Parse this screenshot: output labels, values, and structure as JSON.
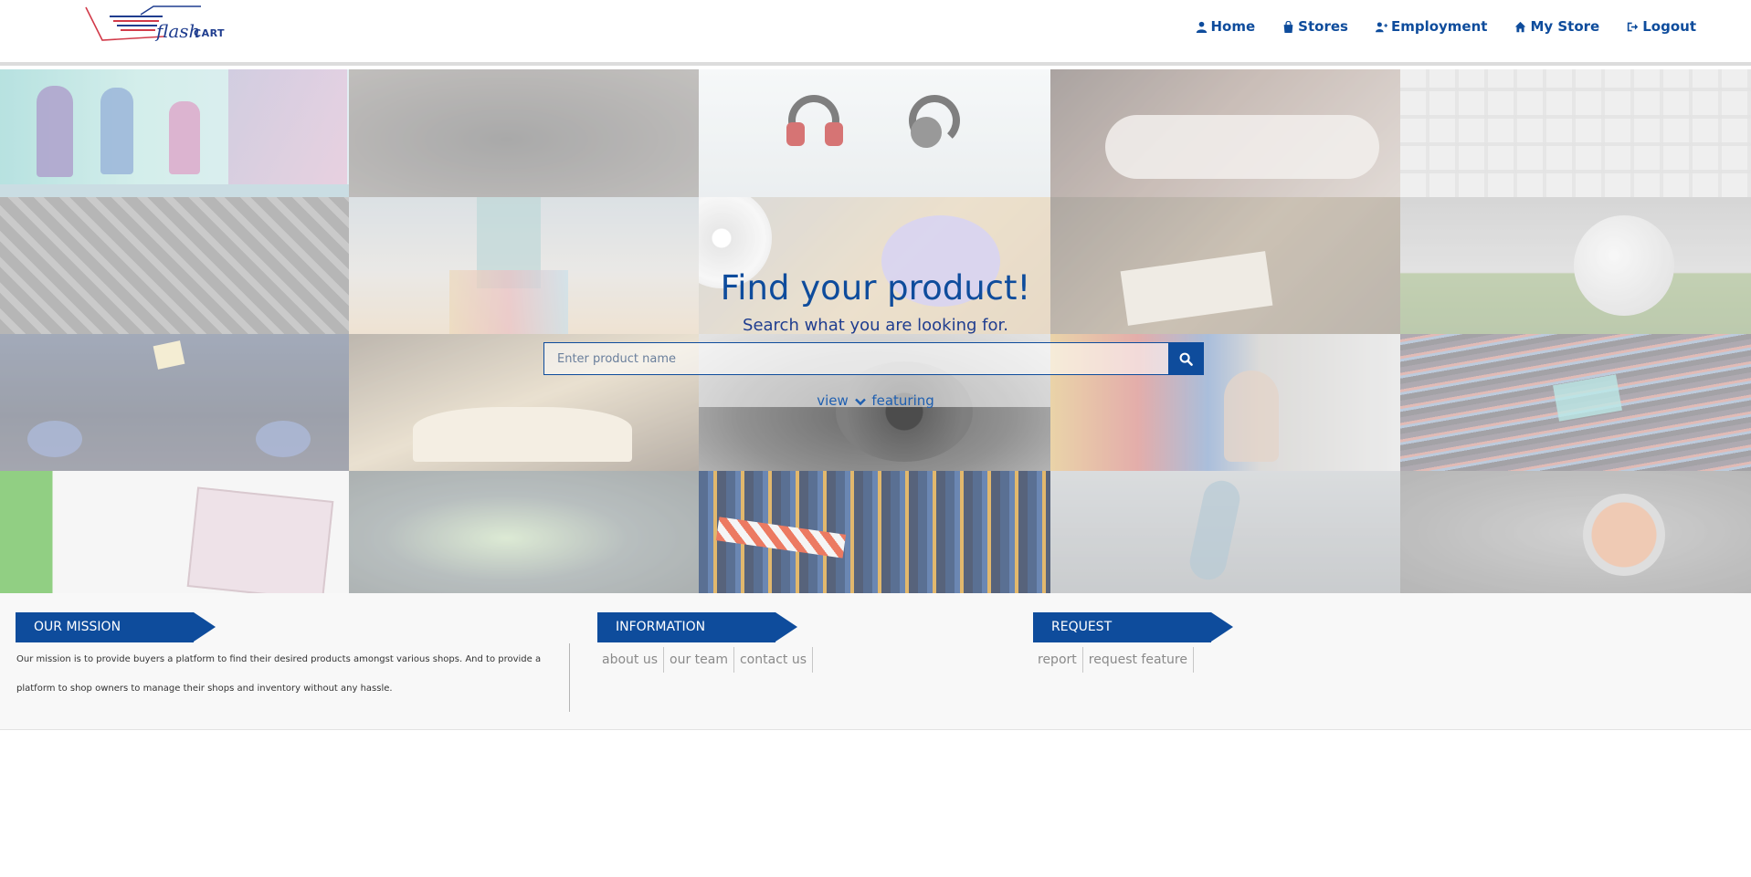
{
  "brand": {
    "name": "flash",
    "suffix": "CART"
  },
  "nav": {
    "items": [
      {
        "label": "Home",
        "icon": "user-icon"
      },
      {
        "label": "Stores",
        "icon": "shopping-bag-icon"
      },
      {
        "label": "Employment",
        "icon": "user-plus-icon"
      },
      {
        "label": "My Store",
        "icon": "home-icon"
      },
      {
        "label": "Logout",
        "icon": "sign-out-icon"
      }
    ]
  },
  "hero": {
    "title": "Find your product!",
    "subtitle": "Search what you are looking for.",
    "search_placeholder": "Enter product name",
    "view_label": "view",
    "featuring_label": "featuring"
  },
  "footer": {
    "mission": {
      "heading": "OUR MISSION",
      "text": "Our mission is to provide buyers a platform to find their desired products amongst various shops. And to provide a platform to shop owners to manage their shops and inventory without any hassle."
    },
    "information": {
      "heading": "INFORMATION",
      "links": [
        "about us",
        "our team",
        "contact us"
      ]
    },
    "request": {
      "heading": "REQUEST",
      "links": [
        "report",
        "request feature"
      ]
    }
  },
  "colors": {
    "primary": "#0e4c9c",
    "footer_bg": "#f8f8f8",
    "link_gray": "#8a8a8a"
  }
}
